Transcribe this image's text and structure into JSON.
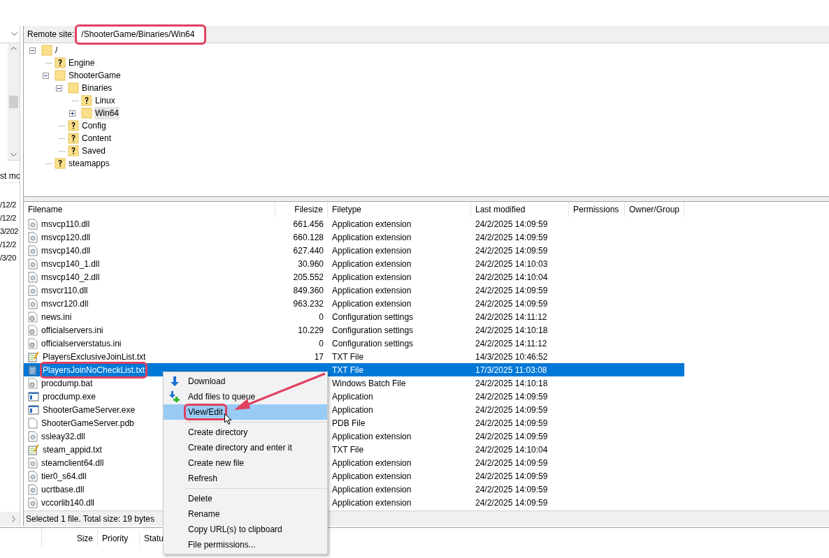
{
  "local_pane": {
    "column_header": "st mo",
    "dates": [
      "/12/2",
      "/12/2",
      "3/202",
      "/12/2",
      "/3/20"
    ]
  },
  "remote_site": {
    "label": "Remote site:",
    "path": "/ShooterGame/Binaries/Win64",
    "highlighted": true
  },
  "tree": [
    {
      "label": "/",
      "kind": "folder",
      "expanded": true,
      "selected": false,
      "children": [
        {
          "label": "Engine",
          "kind": "unknown",
          "selected": false
        },
        {
          "label": "ShooterGame",
          "kind": "folder",
          "expanded": true,
          "selected": false,
          "children": [
            {
              "label": "Binaries",
              "kind": "folder",
              "expanded": true,
              "selected": false,
              "children": [
                {
                  "label": "Linux",
                  "kind": "unknown",
                  "selected": false
                },
                {
                  "label": "Win64",
                  "kind": "folder",
                  "expanded": false,
                  "selected": true
                }
              ]
            },
            {
              "label": "Config",
              "kind": "unknown",
              "selected": false
            },
            {
              "label": "Content",
              "kind": "unknown",
              "selected": false
            },
            {
              "label": "Saved",
              "kind": "unknown",
              "selected": false
            }
          ]
        },
        {
          "label": "steamapps",
          "kind": "unknown",
          "selected": false
        }
      ]
    }
  ],
  "file_list": {
    "columns": [
      "Filename",
      "Filesize",
      "Filetype",
      "Last modified",
      "Permissions",
      "Owner/Group"
    ],
    "rows": [
      {
        "name": "msvcp110.dll",
        "kind": "dll",
        "size": "661.456",
        "type": "Application extension",
        "modified": "24/2/2025 14:09:59",
        "selected": false
      },
      {
        "name": "msvcp120.dll",
        "kind": "dll",
        "size": "660.128",
        "type": "Application extension",
        "modified": "24/2/2025 14:09:59",
        "selected": false
      },
      {
        "name": "msvcp140.dll",
        "kind": "dll",
        "size": "627.440",
        "type": "Application extension",
        "modified": "24/2/2025 14:09:59",
        "selected": false
      },
      {
        "name": "msvcp140_1.dll",
        "kind": "dll",
        "size": "30.960",
        "type": "Application extension",
        "modified": "24/2/2025 14:10:03",
        "selected": false
      },
      {
        "name": "msvcp140_2.dll",
        "kind": "dll",
        "size": "205.552",
        "type": "Application extension",
        "modified": "24/2/2025 14:10:04",
        "selected": false
      },
      {
        "name": "msvcr110.dll",
        "kind": "dll",
        "size": "849.360",
        "type": "Application extension",
        "modified": "24/2/2025 14:09:59",
        "selected": false
      },
      {
        "name": "msvcr120.dll",
        "kind": "dll",
        "size": "963.232",
        "type": "Application extension",
        "modified": "24/2/2025 14:09:59",
        "selected": false
      },
      {
        "name": "news.ini",
        "kind": "ini",
        "size": "0",
        "type": "Configuration settings",
        "modified": "24/2/2025 14:11:12",
        "selected": false
      },
      {
        "name": "officialservers.ini",
        "kind": "ini",
        "size": "10.229",
        "type": "Configuration settings",
        "modified": "24/2/2025 14:10:18",
        "selected": false
      },
      {
        "name": "officialserverstatus.ini",
        "kind": "ini",
        "size": "0",
        "type": "Configuration settings",
        "modified": "24/2/2025 14:11:12",
        "selected": false
      },
      {
        "name": "PlayersExclusiveJoinList.txt",
        "kind": "txt",
        "size": "17",
        "type": "TXT File",
        "modified": "14/3/2025 10:46:52",
        "selected": false
      },
      {
        "name": "PlayersJoinNoCheckList.txt",
        "kind": "notepad",
        "type": "TXT File",
        "modified": "17/3/2025 11:03:08",
        "selected": true,
        "highlighted": true
      },
      {
        "name": "procdump.bat",
        "kind": "ini",
        "type": "Windows Batch File",
        "modified": "24/2/2025 14:10:18",
        "selected": false
      },
      {
        "name": "procdump.exe",
        "kind": "exe",
        "type": "Application",
        "modified": "24/2/2025 14:09:59",
        "selected": false
      },
      {
        "name": "ShooterGameServer.exe",
        "kind": "exe",
        "type": "Application",
        "modified": "24/2/2025 14:09:59",
        "selected": false
      },
      {
        "name": "ShooterGameServer.pdb",
        "kind": "blank",
        "type": "PDB File",
        "modified": "24/2/2025 14:09:59",
        "selected": false
      },
      {
        "name": "ssleay32.dll",
        "kind": "dll",
        "type": "Application extension",
        "modified": "24/2/2025 14:09:59",
        "selected": false
      },
      {
        "name": "steam_appid.txt",
        "kind": "txt",
        "type": "TXT File",
        "modified": "24/2/2025 14:10:04",
        "selected": false
      },
      {
        "name": "steamclient64.dll",
        "kind": "dll",
        "type": "Application extension",
        "modified": "24/2/2025 14:09:59",
        "selected": false
      },
      {
        "name": "tier0_s64.dll",
        "kind": "dll",
        "type": "Application extension",
        "modified": "24/2/2025 14:09:59",
        "selected": false
      },
      {
        "name": "ucrtbase.dll",
        "kind": "dll",
        "type": "Application extension",
        "modified": "24/2/2025 14:09:59",
        "selected": false
      },
      {
        "name": "vccorlib140.dll",
        "kind": "dll",
        "type": "Application extension",
        "modified": "24/2/2025 14:09:59",
        "selected": false
      }
    ]
  },
  "status_bar": "Selected 1 file. Total size: 19 bytes",
  "queue": {
    "columns": [
      "Size",
      "Priority",
      "Statu"
    ]
  },
  "context_menu": {
    "groups": [
      [
        {
          "label": "Download",
          "kind": "download",
          "selected": false
        },
        {
          "label": "Add files to queue",
          "kind": "queue",
          "selected": false
        },
        {
          "label": "View/Edit",
          "kind": "plain",
          "selected": true,
          "highlighted": true
        }
      ],
      [
        {
          "label": "Create directory",
          "kind": "plain",
          "selected": false
        },
        {
          "label": "Create directory and enter it",
          "kind": "plain",
          "selected": false
        },
        {
          "label": "Create new file",
          "kind": "plain",
          "selected": false
        },
        {
          "label": "Refresh",
          "kind": "plain",
          "selected": false
        }
      ],
      [
        {
          "label": "Delete",
          "kind": "plain",
          "selected": false
        },
        {
          "label": "Rename",
          "kind": "plain",
          "selected": false
        },
        {
          "label": "Copy URL(s) to clipboard",
          "kind": "plain",
          "selected": false
        },
        {
          "label": "File permissions...",
          "kind": "plain",
          "selected": false
        }
      ]
    ]
  }
}
